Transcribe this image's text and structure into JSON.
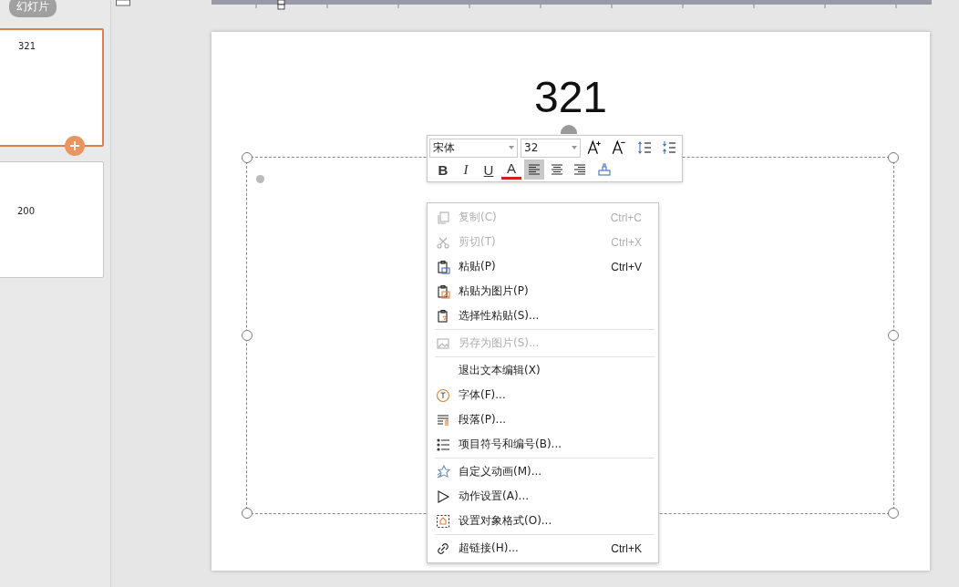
{
  "sidebar": {
    "label": "幻灯片",
    "slides": [
      {
        "text": "321",
        "selected": true
      },
      {
        "text": "200",
        "selected": false
      }
    ]
  },
  "slide": {
    "title": "321"
  },
  "mini_toolbar": {
    "font": "宋体",
    "size": "32",
    "format_buttons": [
      {
        "text": "B",
        "kind": "bold",
        "selected": false
      },
      {
        "text": "I",
        "kind": "italic",
        "selected": false
      },
      {
        "text": "U",
        "kind": "underline",
        "selected": false
      },
      {
        "text": "A",
        "kind": "color",
        "selected": false
      }
    ],
    "align_buttons": [
      {
        "selected": true
      },
      {
        "selected": false
      },
      {
        "selected": false
      }
    ]
  },
  "context_menu": {
    "groups": [
      [
        {
          "label": "复制(C)",
          "shortcut": "Ctrl+C",
          "disabled": true
        },
        {
          "label": "剪切(T)",
          "shortcut": "Ctrl+X",
          "disabled": true
        },
        {
          "label": "粘贴(P)",
          "shortcut": "Ctrl+V",
          "disabled": false
        },
        {
          "label": "粘贴为图片(P)",
          "disabled": false
        },
        {
          "label": "选择性粘贴(S)...",
          "disabled": false
        }
      ],
      [
        {
          "label": "另存为图片(S)...",
          "disabled": true
        }
      ],
      [
        {
          "label": "退出文本编辑(X)",
          "disabled": false
        },
        {
          "label": "字体(F)...",
          "disabled": false
        },
        {
          "label": "段落(P)...",
          "disabled": false
        },
        {
          "label": "项目符号和编号(B)...",
          "disabled": false
        }
      ],
      [
        {
          "label": "自定义动画(M)...",
          "disabled": false
        },
        {
          "label": "动作设置(A)...",
          "disabled": false
        },
        {
          "label": "设置对象格式(O)...",
          "disabled": false
        }
      ],
      [
        {
          "label": "超链接(H)...",
          "shortcut": "Ctrl+K",
          "disabled": false
        }
      ]
    ]
  }
}
